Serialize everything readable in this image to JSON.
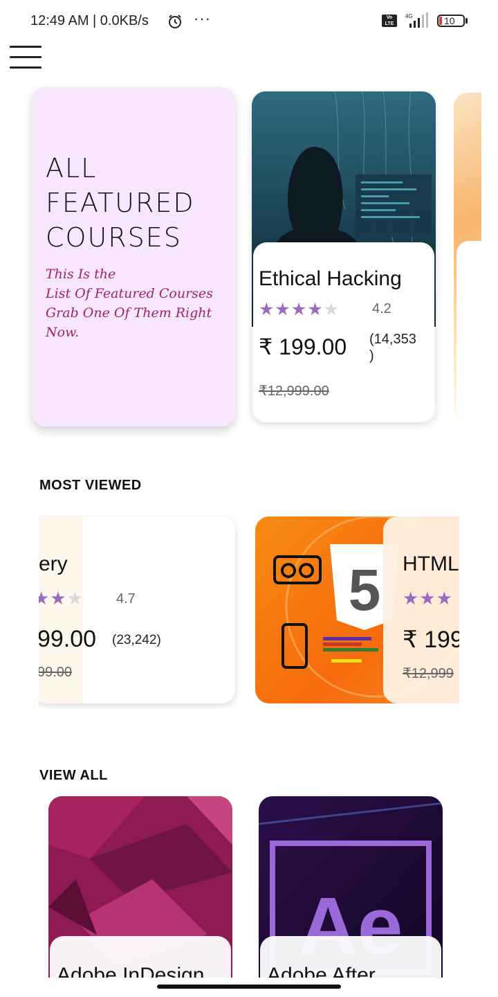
{
  "status_bar": {
    "time": "12:49 AM | 0.0KB/s",
    "more": "···",
    "volte": "Vo LTE",
    "network": "4G",
    "battery": "10"
  },
  "featured": {
    "heading": "ALL\nFEATURED\nCOURSES",
    "description": "This Is the\n List Of Featured Courses\nGrab One Of Them Right\nNow.",
    "courses": [
      {
        "title": "Ethical Hacking",
        "rating": "4.2",
        "stars_filled": 4,
        "price": "₹ 199.00",
        "reviews": "(14,353\n)",
        "original_price": "₹12,999.00"
      }
    ]
  },
  "most_viewed": {
    "heading": "MOST VIEWED",
    "courses": [
      {
        "title": "ery",
        "rating": "4.7",
        "price": "99.00",
        "reviews": "(23,242)",
        "original_price": "99.00"
      },
      {
        "title": "HTML",
        "price": "₹ 199",
        "original_price": "₹12,999"
      }
    ]
  },
  "view_all": {
    "heading": "VIEW ALL",
    "courses": [
      {
        "title": "Adobe InDesign"
      },
      {
        "title": "Adobe After"
      }
    ]
  },
  "colors": {
    "accent": "#9b6bc0",
    "featured_bg": "#f8e6fc",
    "featured_text": "#a0236b"
  }
}
